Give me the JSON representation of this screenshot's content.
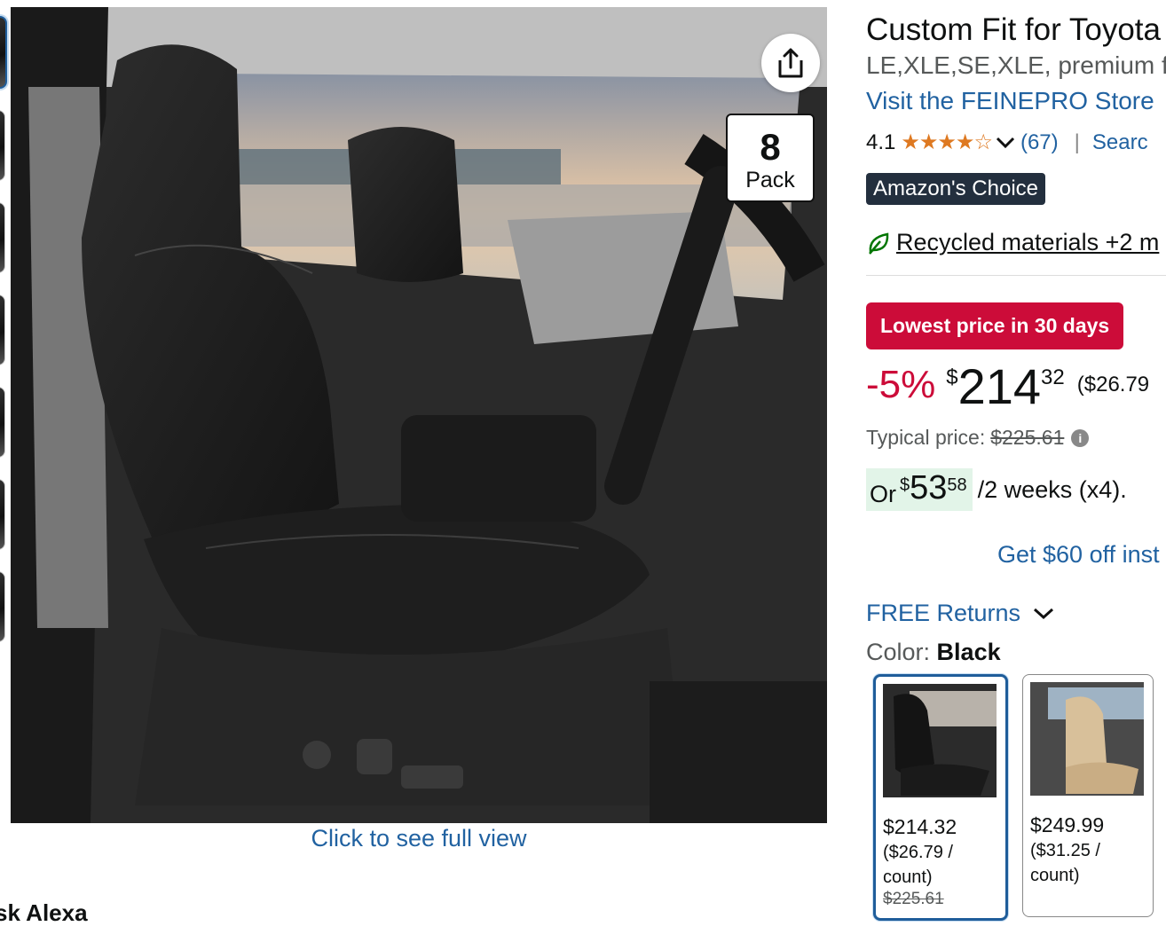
{
  "gallery": {
    "thumbnail_count": 7,
    "full_view_link": "Click to see full view",
    "pack_badge": {
      "number": "8",
      "word": "Pack"
    },
    "share_icon": "share-icon"
  },
  "footer": {
    "ask_alexa": "sk Alexa"
  },
  "product": {
    "title": "Custom Fit for Toyota",
    "subtitle": "LE,XLE,SE,XLE, premium fa",
    "store_link": "Visit the FEINEPRO Store",
    "rating": {
      "value": "4.1",
      "stars_display": "★★★★☆",
      "stars_value": 4.1,
      "count": "(67)",
      "separator": "|",
      "search_link": "Searc"
    },
    "choice_badge": "Amazon's Choice",
    "sustainability": {
      "label": "Recycled materials +2 m",
      "icon": "leaf-icon"
    },
    "deal_badge": "Lowest price in 30 days",
    "price": {
      "discount": "-5%",
      "currency": "$",
      "whole": "214",
      "fraction": "32",
      "per_unit": "($26.79"
    },
    "typical_price": {
      "label": "Typical price:",
      "value": "$225.61",
      "info_icon": "i"
    },
    "installment": {
      "prefix": "Or",
      "currency": "$",
      "whole": "53",
      "fraction": "58",
      "suffix": "/2 weeks (x4)."
    },
    "promo_link": "Get $60 off inst",
    "returns": "FREE Returns",
    "color": {
      "label": "Color:",
      "value": "Black",
      "options": [
        {
          "price": "$214.32",
          "unit": "($26.79 / count)",
          "typical": "$225.61",
          "selected": true
        },
        {
          "price": "$249.99",
          "unit": "($31.25 / count)",
          "typical": "",
          "selected": false
        }
      ]
    }
  },
  "colors": {
    "link": "#2162a1",
    "deal_red": "#cc0c39",
    "star_orange": "#de7921",
    "choice_bg": "#232f3e",
    "install_bg": "#e2f4e8",
    "selected_border": "#1f5d9a"
  }
}
